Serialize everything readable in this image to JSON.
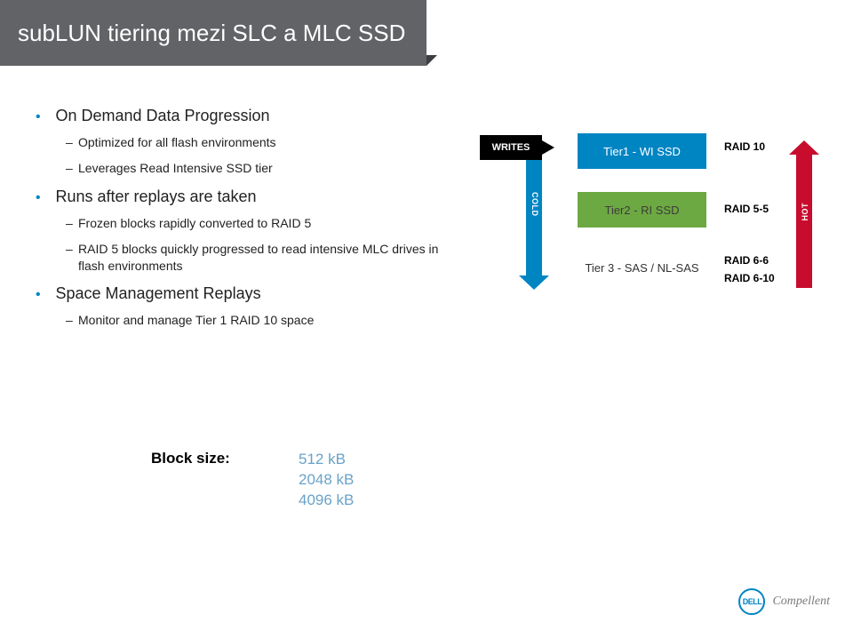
{
  "title": "subLUN tiering mezi SLC a MLC SSD",
  "bullets": {
    "b1": "On Demand Data Progression",
    "b1_sub1": "Optimized for all flash environments",
    "b1_sub2": "Leverages Read Intensive SSD tier",
    "b2": "Runs after replays are taken",
    "b2_sub1": "Frozen blocks rapidly converted to RAID 5",
    "b2_sub2": "RAID 5 blocks quickly progressed to read intensive MLC drives in flash environments",
    "b3": "Space Management Replays",
    "b3_sub1": "Monitor and manage Tier 1 RAID 10 space"
  },
  "diagram": {
    "writes": "WRITES",
    "cold": "COLD",
    "hot": "HOT",
    "tier1": "Tier1 - WI SSD",
    "tier2": "Tier2 - RI SSD",
    "tier3": "Tier 3 - SAS / NL-SAS",
    "raid1": "RAID 10",
    "raid2": "RAID 5-5",
    "raid3": "RAID 6-6",
    "raid4": "RAID 6-10"
  },
  "block": {
    "label": "Block size:",
    "v1": "512 kB",
    "v2": "2048 kB",
    "v3": "4096 kB"
  },
  "footer": {
    "dell": "DELL",
    "compellent": "Compellent"
  }
}
